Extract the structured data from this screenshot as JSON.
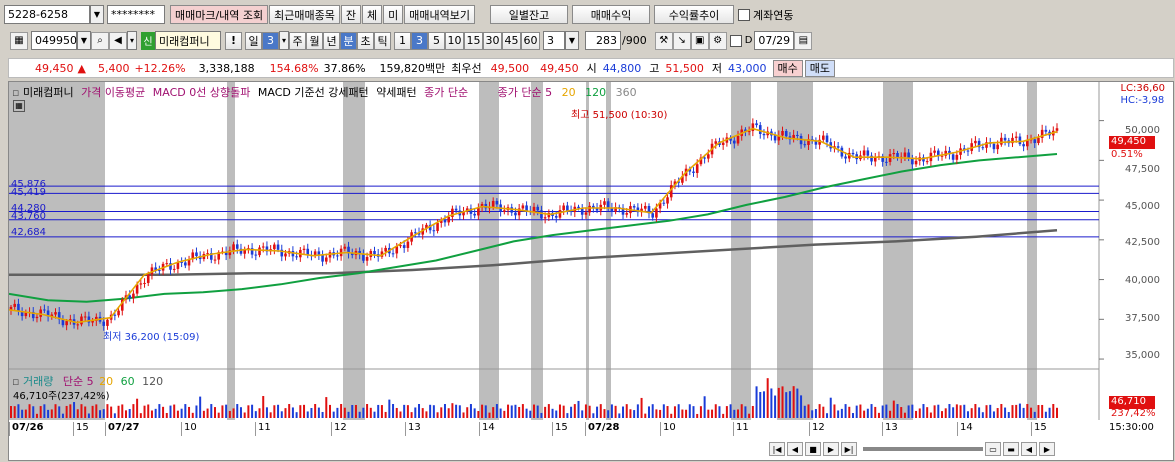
{
  "toolbar1": {
    "account": "5228-6258",
    "password": "********",
    "buttons": [
      "매매마크/내역 조회",
      "최근매매종목",
      "잔",
      "체",
      "미",
      "매매내역보기"
    ],
    "right_buttons": [
      "일별잔고",
      "매매수익",
      "수익률추이"
    ],
    "checkbox_label": "계좌연동"
  },
  "toolbar2": {
    "code": "049950",
    "name": "미래컴퍼니",
    "period_buttons": [
      "일",
      "3",
      "주",
      "월",
      "년",
      "분",
      "초",
      "틱",
      "1",
      "3",
      "5",
      "10",
      "15",
      "30",
      "45",
      "60"
    ],
    "selected_periods": [
      "3",
      "분",
      "3"
    ],
    "count": "3",
    "bars": "283",
    "bars_total": "/900",
    "date": "07/29",
    "tag_shin": "신"
  },
  "quote": {
    "price": "49,450",
    "arrow": "▲",
    "change": "5,400",
    "change_pct": "+12.26%",
    "volume": "3,338,188",
    "vol_ratio": "154.68%",
    "turnover": "37.86%",
    "amount": "159,820백만",
    "ask_label": "최우선",
    "ask": "49,500",
    "bid": "49,450",
    "open_label": "시",
    "open": "44,800",
    "high_label": "고",
    "high": "51,500",
    "low_label": "저",
    "low": "43,000",
    "buy": "매수",
    "sell": "매도"
  },
  "legend": {
    "name": "미래컴퍼니",
    "items": [
      "가격 이동평균",
      "MACD 0선 상향돌파",
      "MACD 기준선 강세패턴",
      "약세패턴",
      "종가 단순"
    ],
    "ma_label": "종가 단순 5",
    "ma20": "20",
    "ma120": "120",
    "ma360": "360",
    "lc": "LC:36,60",
    "hc": "HC:-3,98"
  },
  "annotations": {
    "high": "최고 51,500 (10:30)",
    "low": "최저 36,200 (15:09)",
    "levels": [
      "45,876",
      "45,419",
      "44,280",
      "43,760",
      "42,684"
    ],
    "price_box": "49,450",
    "price_pct": "0.51%"
  },
  "y_axis": [
    "50,000",
    "47,500",
    "45,000",
    "42,500",
    "40,000",
    "37,500",
    "35,000"
  ],
  "volume_panel": {
    "legend_main": "거래량",
    "legend_ma": "단순 5",
    "ma20": "20",
    "ma60": "60",
    "ma120": "120",
    "current": "46,710주(237,42%)",
    "box_value": "46,710",
    "box_pct": "237,42%"
  },
  "x_axis": {
    "labels": [
      "07/26",
      "15",
      "07/27",
      "10",
      "11",
      "12",
      "13",
      "14",
      "15",
      "07/28",
      "10",
      "11",
      "12",
      "13",
      "14",
      "15"
    ],
    "time": "15:30:00"
  },
  "colors": {
    "up": "#e01010",
    "down": "#1a3cd8",
    "ma5": "#e6a500",
    "ma20": "#10a040",
    "ma120": "#606060",
    "shade": "#bdbdbd"
  },
  "chart_data": {
    "type": "candlestick",
    "ma5_values": [
      38100,
      37800,
      37300,
      37600,
      40300,
      41100,
      41600,
      41900,
      41800,
      41500,
      41700,
      41500,
      42800,
      44000,
      44600,
      44400,
      44100,
      44500,
      44500,
      44200,
      46700,
      48600,
      49500,
      48900,
      48700,
      47700,
      47700,
      47600,
      48000,
      48600,
      48700,
      49300
    ],
    "ma20_values": [
      39100,
      38700,
      38600,
      38800,
      39100,
      39200,
      39400,
      39700,
      40100,
      40400,
      40800,
      41200,
      41800,
      42400,
      42800,
      43100,
      43400,
      43700,
      44100,
      44700,
      45200,
      45800,
      46300,
      46800,
      47200,
      47500,
      47700,
      47900
    ],
    "ma120_values": [
      40300,
      40300,
      40300,
      40400,
      40400,
      40600,
      40900,
      41300,
      41600,
      41900,
      42200,
      42400,
      42700,
      43100
    ],
    "ylim": [
      34500,
      51800
    ]
  }
}
